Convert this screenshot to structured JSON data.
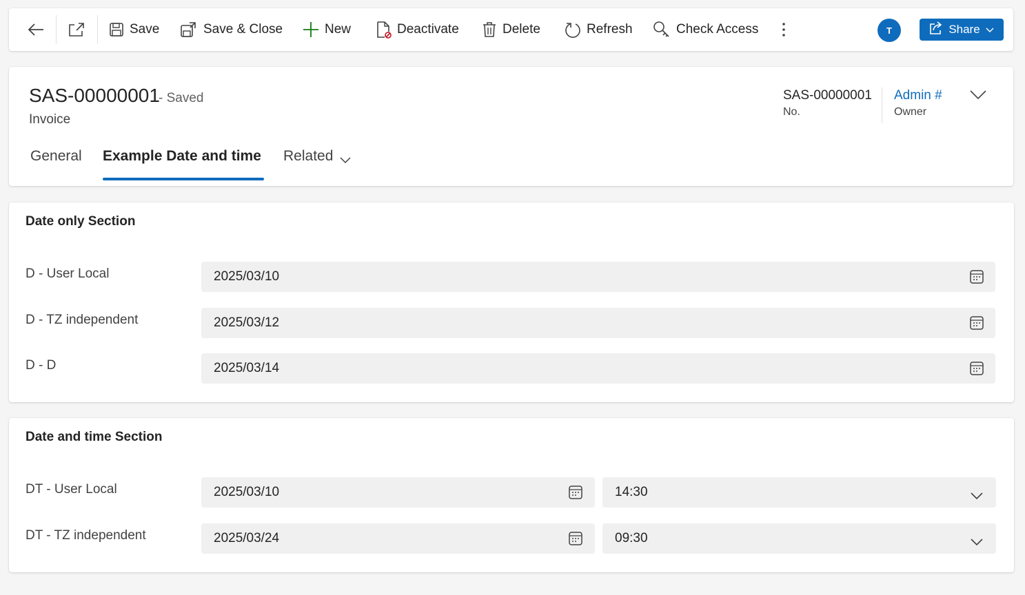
{
  "toolbar": {
    "back_icon": "arrow-left-icon",
    "popout_icon": "open-in-new-window-icon",
    "save_label": "Save",
    "save_close_label": "Save & Close",
    "new_label": "New",
    "deactivate_label": "Deactivate",
    "delete_label": "Delete",
    "refresh_label": "Refresh",
    "check_access_label": "Check Access",
    "more_icon": "more-vertical-icon",
    "avatar_initial": "T",
    "share_label": "Share",
    "accent_color": "#0f6cbd",
    "new_icon_color": "#107c10"
  },
  "header": {
    "title": "SAS-00000001",
    "status": "- Saved",
    "entity": "Invoice",
    "fields": [
      {
        "value": "SAS-00000001",
        "label": "No."
      },
      {
        "value": "Admin #",
        "label": "Owner"
      }
    ],
    "tabs": [
      {
        "label": "General"
      },
      {
        "label": "Example Date and time"
      },
      {
        "label": "Related"
      }
    ],
    "active_tab": "Example Date and time"
  },
  "sections": {
    "date_only": {
      "title": "Date only Section",
      "fields": [
        {
          "label": "D - User Local",
          "value": "2025/03/10"
        },
        {
          "label": "D - TZ independent",
          "value": "2025/03/12"
        },
        {
          "label": "D - D",
          "value": "2025/03/14"
        }
      ]
    },
    "date_time": {
      "title": "Date and time Section",
      "fields": [
        {
          "label": "DT - User Local",
          "date": "2025/03/10",
          "time": "14:30"
        },
        {
          "label": "DT - TZ independent",
          "date": "2025/03/24",
          "time": "09:30"
        }
      ]
    }
  }
}
